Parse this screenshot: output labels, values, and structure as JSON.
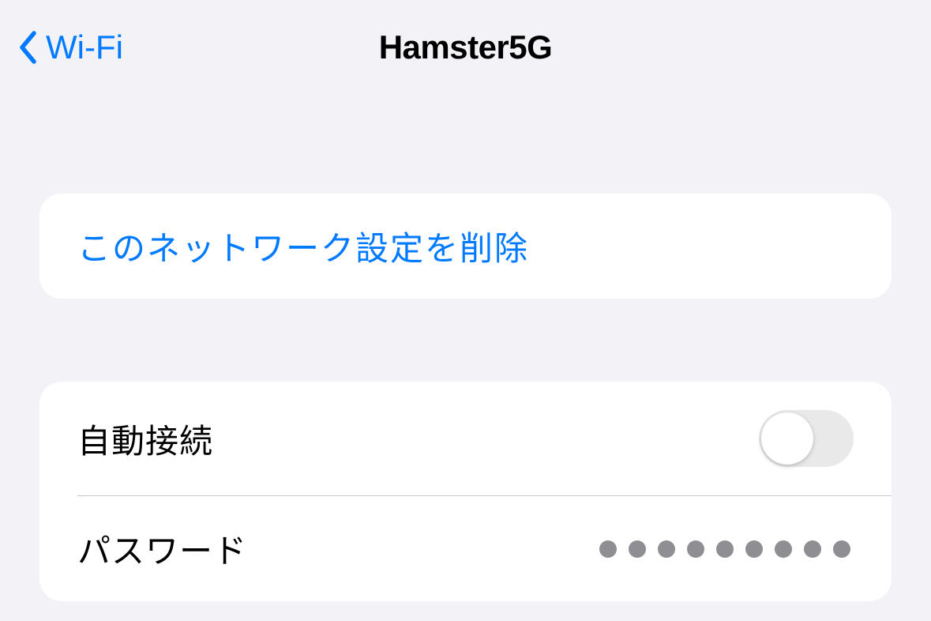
{
  "nav": {
    "back_label": "Wi-Fi",
    "title": "Hamster5G"
  },
  "sections": {
    "forget": {
      "label": "このネットワーク設定を削除"
    },
    "settings": {
      "auto_join_label": "自動接続",
      "auto_join_on": false,
      "password_label": "パスワード",
      "password_dot_count": 9
    }
  }
}
